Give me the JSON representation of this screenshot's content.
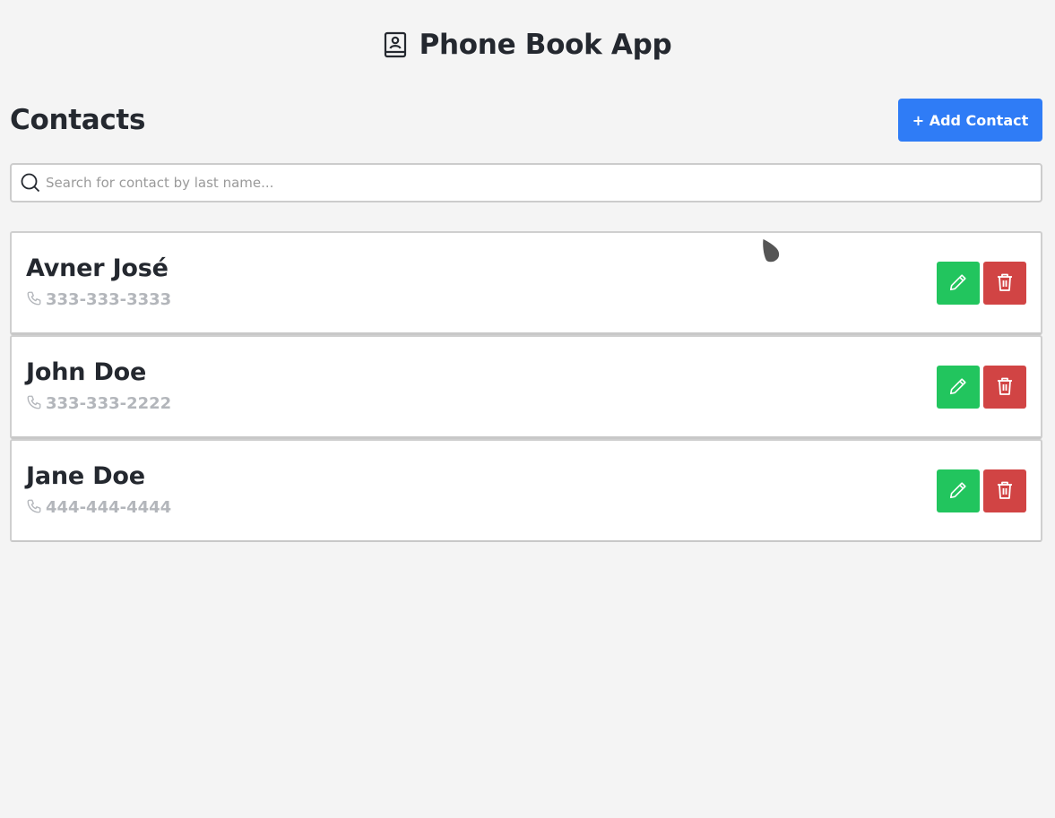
{
  "header": {
    "title": "Phone Book App",
    "icon": "address-book-icon"
  },
  "contacts_section": {
    "title": "Contacts",
    "add_button_label": "+ Add Contact"
  },
  "search": {
    "placeholder": "Search for contact by last name...",
    "value": "",
    "icon": "search-icon"
  },
  "contacts": [
    {
      "name": "Avner José",
      "phone": "333-333-3333"
    },
    {
      "name": "John Doe",
      "phone": "333-333-2222"
    },
    {
      "name": "Jane Doe",
      "phone": "444-444-4444"
    }
  ],
  "colors": {
    "background": "#f4f4f4",
    "primary": "#2f7cf6",
    "edit": "#22c55e",
    "delete": "#d14444",
    "phone_text": "#b3b6bb"
  },
  "icons": {
    "phone": "phone-icon",
    "edit": "pencil-icon",
    "delete": "trash-icon"
  }
}
